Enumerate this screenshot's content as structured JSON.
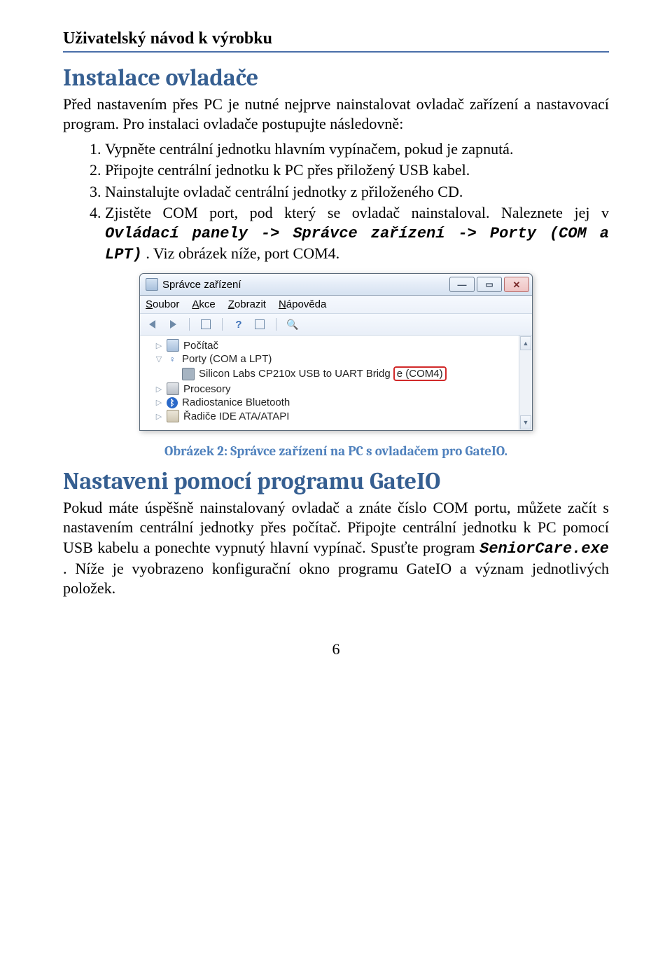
{
  "docHeader": "Uživatelský návod k výrobku",
  "section1": {
    "title": "Instalace ovladače",
    "intro": "Před nastavením přes PC je nutné nejprve nainstalovat ovladač zařízení a nastavovací program. Pro instalaci ovladače postupujte následovně:",
    "steps": {
      "s1": "Vypněte centrální jednotku hlavním vypínačem, pokud je zapnutá.",
      "s2": "Připojte centrální jednotku k PC přes přiložený USB kabel.",
      "s3": "Nainstalujte ovladač centrální jednotky z přiloženého CD.",
      "s4_a": "Zjistěte COM port, pod který se ovladač nainstaloval. Naleznete jej v ",
      "s4_path": "Ovládací panely -> Správce zařízení -> Porty (COM a LPT)",
      "s4_b": ". Viz obrázek níže, port COM4."
    }
  },
  "devmgr": {
    "title": "Správce zařízení",
    "menu": {
      "file": "Soubor",
      "action": "Akce",
      "view": "Zobrazit",
      "help": "Nápověda"
    },
    "tree": {
      "pc": "Počítač",
      "ports": "Porty (COM a LPT)",
      "usb_uart_a": "Silicon Labs CP210x USB to UART Bridg",
      "usb_uart_b": "e (COM4)",
      "cpu": "Procesory",
      "bt": "Radiostanice Bluetooth",
      "ide": "Řadiče IDE ATA/ATAPI"
    }
  },
  "caption": "Obrázek 2: Správce zařízení na PC s ovladačem pro GateIO.",
  "section2": {
    "title": "Nastaveni pomocí programu GateIO",
    "body_a": "Pokud máte úspěšně nainstalovaný ovladač a znáte číslo COM portu, můžete začít s nastavením centrální jednotky přes počítač. Připojte centrální jednotku k PC pomocí USB kabelu a ponechte vypnutý hlavní vypínač. Spusťte program ",
    "body_exe": "SeniorCare.exe",
    "body_b": ". Níže je vyobrazeno konfigurační okno programu GateIO a význam jednotlivých položek."
  },
  "pageNumber": "6"
}
